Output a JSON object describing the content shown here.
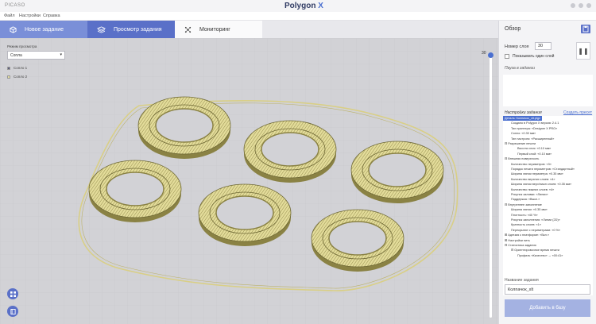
{
  "app": {
    "name": "PICASO",
    "logo_text": "Polygon",
    "logo_mark": "X"
  },
  "menu": [
    "Файл",
    "Настройки",
    "Справка"
  ],
  "tabs": [
    {
      "label": "Новое задание",
      "icon": "cube-icon",
      "state": "inactive"
    },
    {
      "label": "Просмотр задания",
      "icon": "layers-icon",
      "state": "active"
    },
    {
      "label": "Мониторинг",
      "icon": "network-icon",
      "state": "inactive"
    }
  ],
  "viewport": {
    "mode_label": "Режим просмотра",
    "mode_value": "Сопла",
    "legend": [
      {
        "label": "Сопло 1",
        "color": "#5c5c7a"
      },
      {
        "label": "Сопло 2",
        "color": "#e6e0a0"
      }
    ],
    "layer_top_value": "30",
    "model_color": "#d9cf86",
    "bed_color": "#d0d0d4"
  },
  "panel": {
    "title": "Обзор",
    "layer_number_label": "Номер слоя",
    "layer_number_value": "30",
    "show_one_layer_label": "Показывать один слой",
    "search_placeholder": "Пауза в задании",
    "settings_title": "Настройки задания",
    "create_preset_label": "Создать пресет",
    "tree": [
      {
        "text": "Деталь: Колпачок_xlt.plgx",
        "level": 0,
        "selected": true
      },
      {
        "text": "Создано в Polygon X версия: 2.4.1",
        "level": 1
      },
      {
        "text": "Тип принтера: «Designer X PRO»",
        "level": 1
      },
      {
        "text": "Сопло: «0.30 мм»",
        "level": 1
      },
      {
        "text": "Тип настроек: «Расширенный»",
        "level": 1
      },
      {
        "text": "⊟ Разрешение печати",
        "level": 0
      },
      {
        "text": "Высота слоя: «0.10 мм»",
        "level": 2
      },
      {
        "text": "Первый слой: «0.10 мм»",
        "level": 2
      },
      {
        "text": "⊟ Внешняя поверхность",
        "level": 0
      },
      {
        "text": "Количество периметров: «3»",
        "level": 1
      },
      {
        "text": "Порядок печати периметров: «Стандартный»",
        "level": 1
      },
      {
        "text": "Ширина линии периметра: «0.35 мм»",
        "level": 1
      },
      {
        "text": "Количество верхних слоев: «4»",
        "level": 1
      },
      {
        "text": "Ширина линии верх/нижн слоев: «0.35 мм»",
        "level": 1
      },
      {
        "text": "Количество нижних слоев: «4»",
        "level": 1
      },
      {
        "text": "Рисунок заливки: «Линии»",
        "level": 1
      },
      {
        "text": "Поддержка: «Выкл.»",
        "level": 1
      },
      {
        "text": "⊟ Внутреннее заполнение",
        "level": 0
      },
      {
        "text": "Ширина линии: «0.35 мм»",
        "level": 1
      },
      {
        "text": "Плотность: «40 %»",
        "level": 1
      },
      {
        "text": "Рисунок заполнения: «Линии (2D)»",
        "level": 1
      },
      {
        "text": "Кратность слоев: «1»",
        "level": 1
      },
      {
        "text": "Перекрытие с периметрами: «0 %»",
        "level": 1
      },
      {
        "text": "⊞ Адгезия к платформе: «Вкл.»",
        "level": 0
      },
      {
        "text": "⊞ Настройки нить",
        "level": 0
      },
      {
        "text": "⊟ Статистика задания",
        "level": 0
      },
      {
        "text": "⊟ Ориентировочное время печати",
        "level": 1
      },
      {
        "text": "Профиль «Качество» → «00:41»",
        "level": 2
      }
    ],
    "task_name_label": "Название задания",
    "task_name_value": "Колпачок_xlt",
    "add_to_queue_label": "Добавить в базу"
  },
  "colors": {
    "accent": "#5a70c8",
    "accent_light": "#7a8fd8",
    "selection": "#4a6fd0"
  }
}
